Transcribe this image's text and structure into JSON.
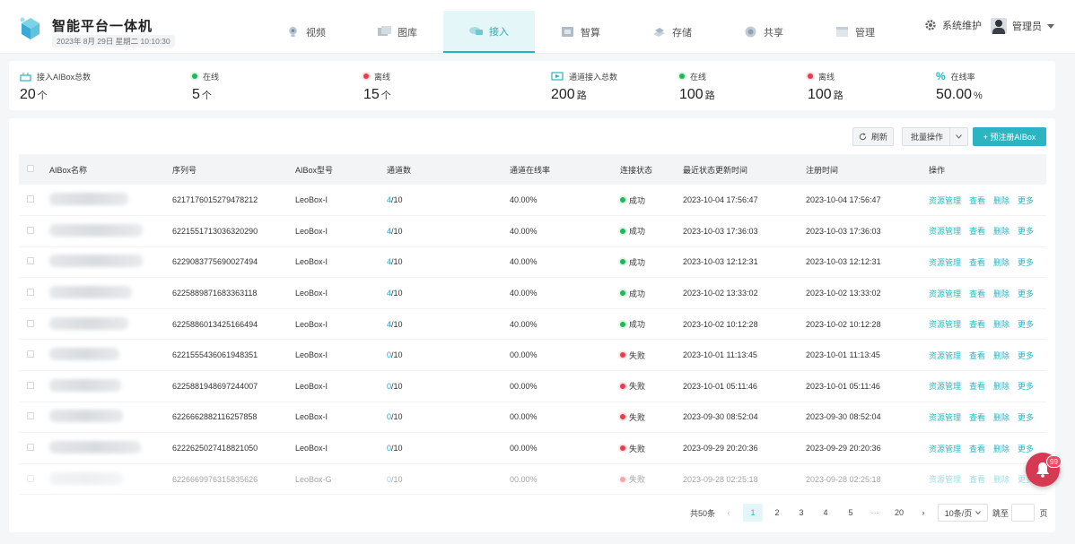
{
  "header": {
    "app_title": "智能平台一体机",
    "datetime": "2023年 8月 29日  星期二  10:10:30",
    "nav": [
      {
        "label": "视频",
        "icon": "camera-icon"
      },
      {
        "label": "图库",
        "icon": "gallery-icon"
      },
      {
        "label": "接入",
        "icon": "access-icon",
        "active": true
      },
      {
        "label": "智算",
        "icon": "compute-icon"
      },
      {
        "label": "存储",
        "icon": "storage-icon"
      },
      {
        "label": "共享",
        "icon": "share-icon"
      },
      {
        "label": "管理",
        "icon": "manage-icon"
      }
    ],
    "system_label": "系统维护",
    "user_label": "管理员"
  },
  "stats": {
    "aibox_total": {
      "label": "接入AIBox总数",
      "value": "20",
      "unit": "个"
    },
    "aibox_online": {
      "label": "在线",
      "value": "5",
      "unit": "个"
    },
    "aibox_offline": {
      "label": "离线",
      "value": "15",
      "unit": "个"
    },
    "channel_total": {
      "label": "通道接入总数",
      "value": "200",
      "unit": "路"
    },
    "channel_online": {
      "label": "在线",
      "value": "100",
      "unit": "路"
    },
    "channel_offline": {
      "label": "离线",
      "value": "100",
      "unit": "路"
    },
    "online_rate": {
      "label": "在线率",
      "value": "50.00",
      "unit": "%"
    }
  },
  "toolbar": {
    "refresh_label": "刷新",
    "batch_label": "批量操作",
    "preregister_label": "+ 预注册AIBox"
  },
  "table": {
    "headers": [
      "AIBox名称",
      "序列号",
      "AIBox型号",
      "通道数",
      "通道在线率",
      "连接状态",
      "最近状态更新时间",
      "注册时间",
      "操作"
    ],
    "ops": [
      "资源管理",
      "查看",
      "删除",
      "更多"
    ],
    "rows": [
      {
        "serial": "6217176015279478212",
        "model": "LeoBox-I",
        "ch_online": "4",
        "ch_total": "/10",
        "rate": "40.00%",
        "status": "成功",
        "ok": true,
        "updated": "2023-10-04 17:56:47",
        "registered": "2023-10-04 17:56:47"
      },
      {
        "serial": "6221551713036320290",
        "model": "LeoBox-I",
        "ch_online": "4",
        "ch_total": "/10",
        "rate": "40.00%",
        "status": "成功",
        "ok": true,
        "updated": "2023-10-03 17:36:03",
        "registered": "2023-10-03 17:36:03"
      },
      {
        "serial": "6229083775690027494",
        "model": "LeoBox-I",
        "ch_online": "4",
        "ch_total": "/10",
        "rate": "40.00%",
        "status": "成功",
        "ok": true,
        "updated": "2023-10-03 12:12:31",
        "registered": "2023-10-03 12:12:31"
      },
      {
        "serial": "6225889871683363118",
        "model": "LeoBox-I",
        "ch_online": "4",
        "ch_total": "/10",
        "rate": "40.00%",
        "status": "成功",
        "ok": true,
        "updated": "2023-10-02 13:33:02",
        "registered": "2023-10-02 13:33:02"
      },
      {
        "serial": "6225886013425166494",
        "model": "LeoBox-I",
        "ch_online": "4",
        "ch_total": "/10",
        "rate": "40.00%",
        "status": "成功",
        "ok": true,
        "updated": "2023-10-02 10:12:28",
        "registered": "2023-10-02 10:12:28"
      },
      {
        "serial": "6221555436061948351",
        "model": "LeoBox-I",
        "ch_online": "0",
        "ch_total": "/10",
        "rate": "00.00%",
        "status": "失败",
        "ok": false,
        "updated": "2023-10-01 11:13:45",
        "registered": "2023-10-01 11:13:45"
      },
      {
        "serial": "6225881948697244007",
        "model": "LeoBox-I",
        "ch_online": "0",
        "ch_total": "/10",
        "rate": "00.00%",
        "status": "失败",
        "ok": false,
        "updated": "2023-10-01 05:11:46",
        "registered": "2023-10-01 05:11:46"
      },
      {
        "serial": "6226662882116257858",
        "model": "LeoBox-I",
        "ch_online": "0",
        "ch_total": "/10",
        "rate": "00.00%",
        "status": "失败",
        "ok": false,
        "updated": "2023-09-30 08:52:04",
        "registered": "2023-09-30 08:52:04"
      },
      {
        "serial": "6222625027418821050",
        "model": "LeoBox-I",
        "ch_online": "0",
        "ch_total": "/10",
        "rate": "00.00%",
        "status": "失败",
        "ok": false,
        "updated": "2023-09-29 20:20:36",
        "registered": "2023-09-29 20:20:36"
      },
      {
        "serial": "6226669976315835626",
        "model": "LeoBox-G",
        "ch_online": "0",
        "ch_total": "/10",
        "rate": "00.00%",
        "status": "失败",
        "ok": false,
        "updated": "2023-09-28 02:25:18",
        "registered": "2023-09-28 02:25:18"
      }
    ]
  },
  "pagination": {
    "total": "共50条",
    "pages": [
      "1",
      "2",
      "3",
      "4",
      "5",
      "···",
      "20"
    ],
    "current": "1",
    "page_size": "10条/页",
    "goto_label": "跳至",
    "page_unit": "页"
  },
  "notification": {
    "count": "99"
  },
  "colors": {
    "accent": "#2bb5c1",
    "success": "#1db954",
    "danger": "#f0384c"
  }
}
